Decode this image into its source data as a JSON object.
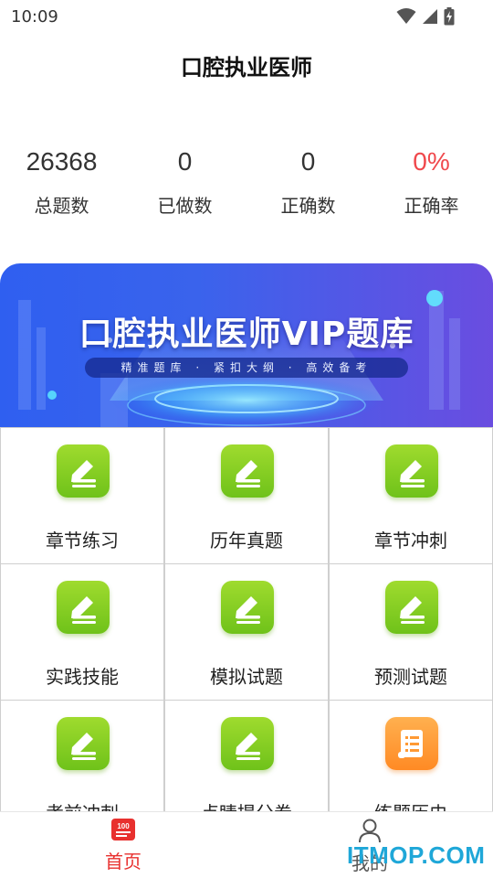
{
  "status_bar": {
    "time": "10:09"
  },
  "header": {
    "title": "口腔执业医师"
  },
  "stats": [
    {
      "value": "26368",
      "label": "总题数",
      "color": "#333333"
    },
    {
      "value": "0",
      "label": "已做数",
      "color": "#333333"
    },
    {
      "value": "0",
      "label": "正确数",
      "color": "#333333"
    },
    {
      "value": "0%",
      "label": "正确率",
      "color": "#f0484c"
    }
  ],
  "banner": {
    "title": "口腔执业医师VIP题库",
    "subtitle": "精准题库 · 紧扣大纲 · 高效备考"
  },
  "grid": {
    "items": [
      {
        "label": "章节练习",
        "icon": "pencil-icon",
        "color": "green"
      },
      {
        "label": "历年真题",
        "icon": "pencil-icon",
        "color": "green"
      },
      {
        "label": "章节冲刺",
        "icon": "pencil-icon",
        "color": "green"
      },
      {
        "label": "实践技能",
        "icon": "pencil-icon",
        "color": "green"
      },
      {
        "label": "模拟试题",
        "icon": "pencil-icon",
        "color": "green"
      },
      {
        "label": "预测试题",
        "icon": "pencil-icon",
        "color": "green"
      },
      {
        "label": "考前冲刺",
        "icon": "pencil-icon",
        "color": "green"
      },
      {
        "label": "点睛提分卷",
        "icon": "pencil-icon",
        "color": "green"
      },
      {
        "label": "练题历史",
        "icon": "scroll-icon",
        "color": "orange"
      }
    ]
  },
  "bottom_nav": {
    "items": [
      {
        "label": "首页",
        "icon": "home-100-icon",
        "active": true
      },
      {
        "label": "我的",
        "icon": "person-icon",
        "active": false
      }
    ]
  },
  "watermark": "ITMOP.COM",
  "colors": {
    "accent": "#e8302e",
    "green_icon": "#7fce22",
    "orange_icon": "#ff9a34"
  }
}
